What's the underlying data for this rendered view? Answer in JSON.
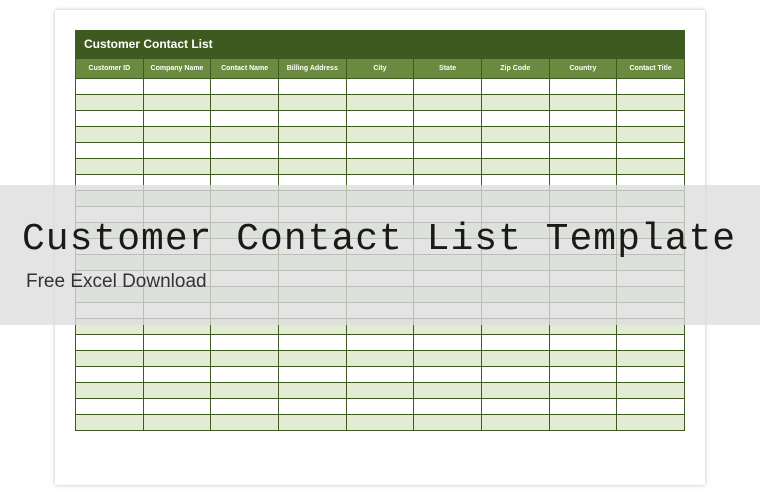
{
  "sheet": {
    "title": "Customer Contact List",
    "columns": [
      "Customer ID",
      "Company Name",
      "Contact Name",
      "Billing Address",
      "City",
      "State",
      "Zip Code",
      "Country",
      "Contact Title"
    ],
    "empty_rows": 22
  },
  "overlay": {
    "title": "Customer Contact List Template",
    "subtitle": "Free Excel Download"
  },
  "colors": {
    "title_bar": "#3e5a20",
    "header_row": "#6a8a3f",
    "stripe": "#e4ebd5",
    "overlay_bg": "rgba(220,220,220,0.78)"
  }
}
